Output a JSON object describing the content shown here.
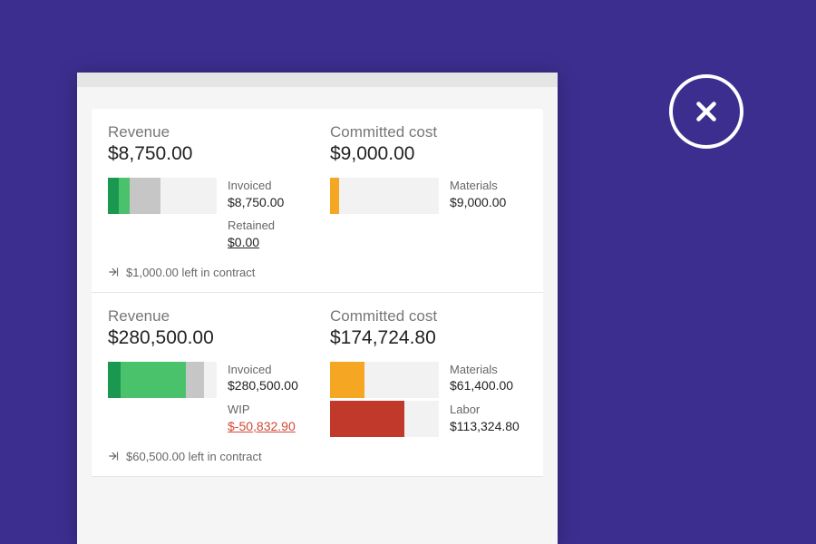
{
  "close_label": "close",
  "cards": [
    {
      "revenue": {
        "title": "Revenue",
        "total": "$8,750.00",
        "bars": [
          {
            "segments": [
              {
                "color": "#1a9850",
                "width": 10
              },
              {
                "color": "#4ac26b",
                "width": 10
              },
              {
                "color": "#c6c6c6",
                "width": 28
              }
            ]
          }
        ],
        "legend": [
          {
            "label": "Invoiced",
            "value": "$8,750.00"
          },
          {
            "label": "Retained",
            "value": "$0.00",
            "underline": true
          }
        ],
        "footnote": "$1,000.00 left in contract"
      },
      "cost": {
        "title": "Committed cost",
        "total": "$9,000.00",
        "bars": [
          {
            "segments": [
              {
                "color": "#f5a623",
                "width": 8
              }
            ]
          }
        ],
        "legend": [
          {
            "label": "Materials",
            "value": "$9,000.00"
          }
        ]
      }
    },
    {
      "revenue": {
        "title": "Revenue",
        "total": "$280,500.00",
        "bars": [
          {
            "segments": [
              {
                "color": "#1a9850",
                "width": 12
              },
              {
                "color": "#4ac26b",
                "width": 60
              },
              {
                "color": "#c6c6c6",
                "width": 16
              }
            ]
          }
        ],
        "legend": [
          {
            "label": "Invoiced",
            "value": "$280,500.00"
          },
          {
            "label": "WIP",
            "value": "$-50,832.90",
            "negative": true
          }
        ],
        "footnote": "$60,500.00 left in contract"
      },
      "cost": {
        "title": "Committed cost",
        "total": "$174,724.80",
        "bars": [
          {
            "segments": [
              {
                "color": "#f5a623",
                "width": 32
              }
            ]
          },
          {
            "segments": [
              {
                "color": "#c0392b",
                "width": 68
              }
            ]
          }
        ],
        "legend": [
          {
            "label": "Materials",
            "value": "$61,400.00"
          },
          {
            "label": "Labor",
            "value": "$113,324.80"
          }
        ]
      }
    }
  ],
  "chart_data": [
    {
      "type": "bar",
      "title": "Revenue",
      "total": 8750.0,
      "series": [
        {
          "name": "Invoiced",
          "values": [
            8750.0
          ]
        },
        {
          "name": "Retained",
          "values": [
            0.0
          ]
        }
      ],
      "footnote_value": 1000.0,
      "footnote_label": "left in contract"
    },
    {
      "type": "bar",
      "title": "Committed cost",
      "total": 9000.0,
      "series": [
        {
          "name": "Materials",
          "values": [
            9000.0
          ]
        }
      ]
    },
    {
      "type": "bar",
      "title": "Revenue",
      "total": 280500.0,
      "series": [
        {
          "name": "Invoiced",
          "values": [
            280500.0
          ]
        },
        {
          "name": "WIP",
          "values": [
            -50832.9
          ]
        }
      ],
      "footnote_value": 60500.0,
      "footnote_label": "left in contract"
    },
    {
      "type": "bar",
      "title": "Committed cost",
      "total": 174724.8,
      "series": [
        {
          "name": "Materials",
          "values": [
            61400.0
          ]
        },
        {
          "name": "Labor",
          "values": [
            113324.8
          ]
        }
      ]
    }
  ]
}
